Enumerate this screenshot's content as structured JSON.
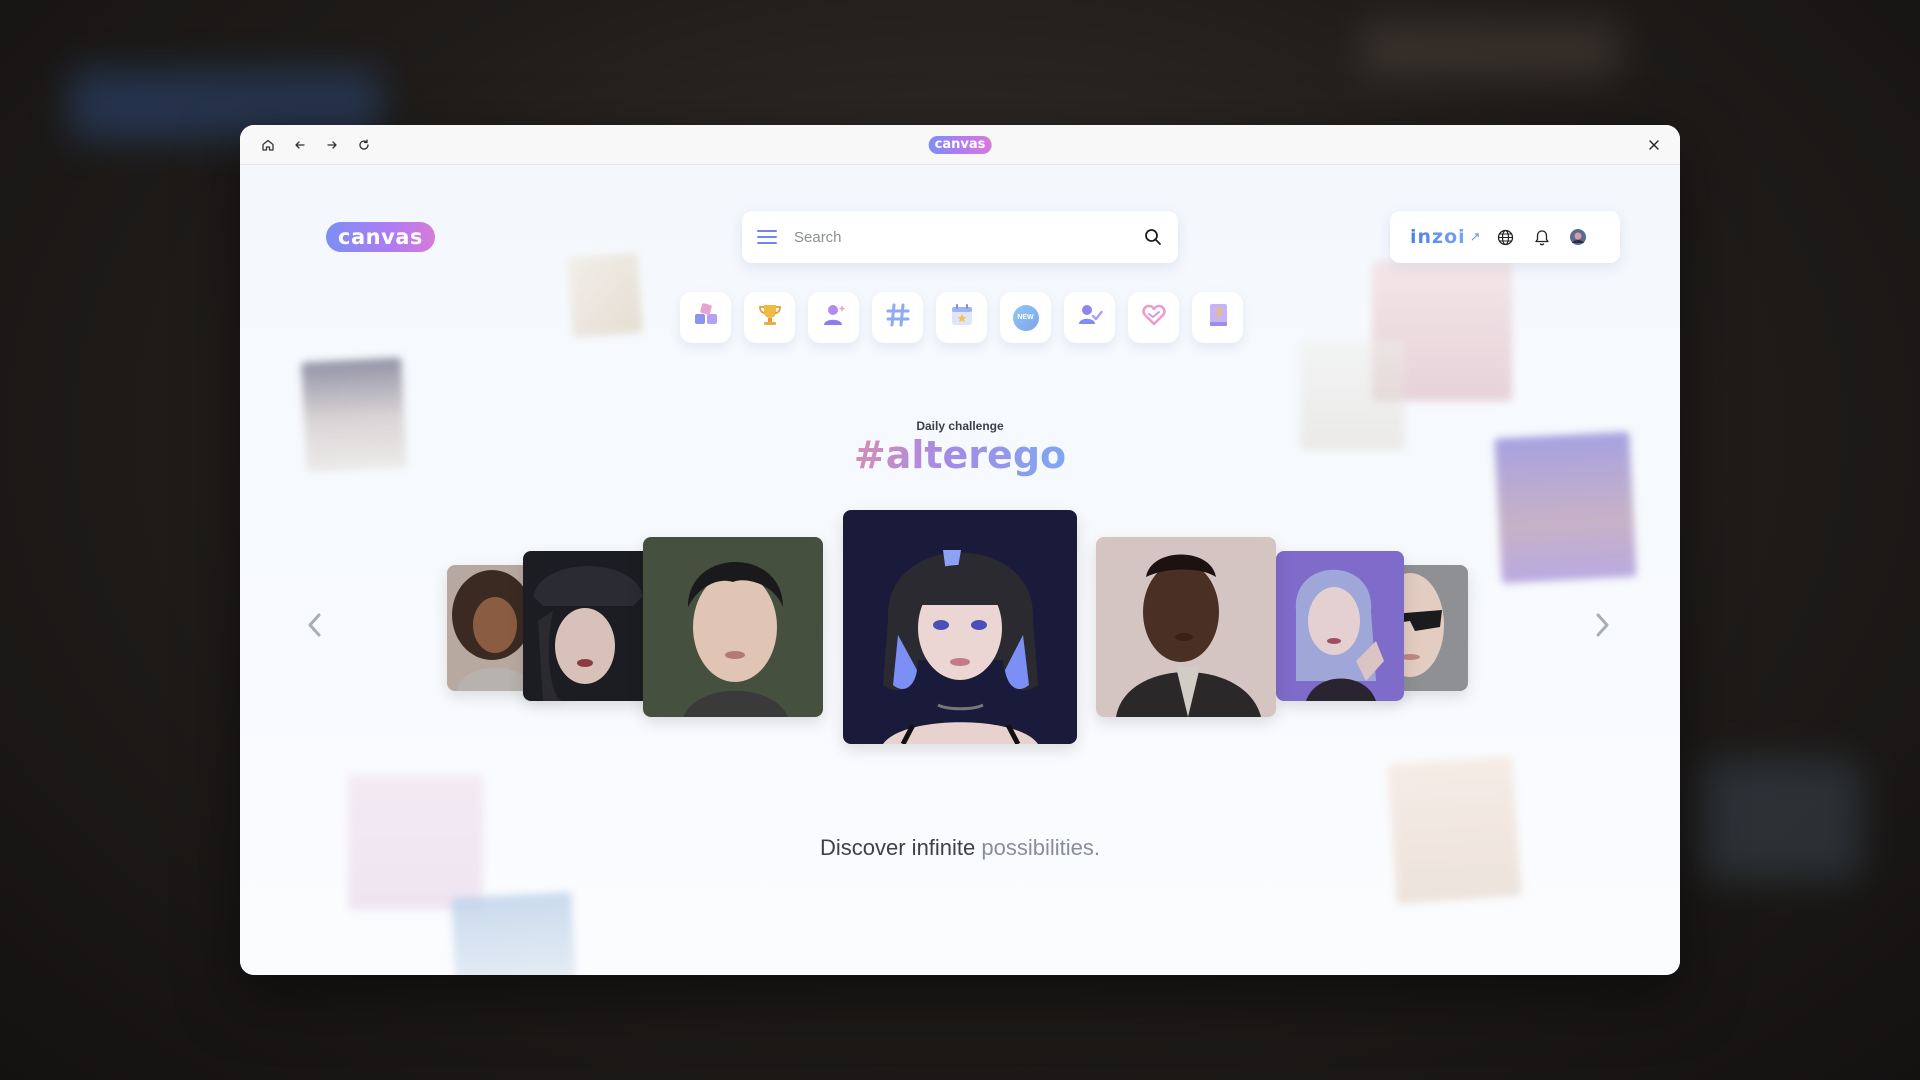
{
  "window": {
    "titlebar": {
      "home_icon": "home-icon",
      "back_icon": "arrow-left-icon",
      "forward_icon": "arrow-right-icon",
      "reload_icon": "reload-icon",
      "title_logo": "canvas",
      "close_icon": "close-icon"
    }
  },
  "header": {
    "logo_text": "canvas",
    "search": {
      "placeholder": "Search",
      "menu_icon": "hamburger-menu-icon",
      "search_icon": "search-icon"
    },
    "right": {
      "brand_link": "inzoi",
      "brand_arrow": "↗",
      "globe_icon": "globe-icon",
      "bell_icon": "bell-icon",
      "avatar": "avatar"
    }
  },
  "categories": [
    {
      "name": "all-categories",
      "icon": "grid-blocks-icon"
    },
    {
      "name": "trophy",
      "icon": "trophy-icon"
    },
    {
      "name": "creators",
      "icon": "person-sparkle-icon"
    },
    {
      "name": "hashtags",
      "icon": "hashtag-icon"
    },
    {
      "name": "events",
      "icon": "calendar-star-icon"
    },
    {
      "name": "new",
      "icon": "new-badge-icon",
      "badge_text": "NEW"
    },
    {
      "name": "following",
      "icon": "person-check-icon"
    },
    {
      "name": "likes",
      "icon": "heart-icon"
    },
    {
      "name": "guide",
      "icon": "book-question-icon"
    }
  ],
  "challenge": {
    "label": "Daily challenge",
    "hashtag": "#alterego"
  },
  "carousel": {
    "prev_icon": "chevron-left-icon",
    "next_icon": "chevron-right-icon",
    "items": [
      {
        "name": "portrait-curly-hair-woman"
      },
      {
        "name": "portrait-black-cap-woman"
      },
      {
        "name": "portrait-young-man"
      },
      {
        "name": "portrait-blue-bob-woman"
      },
      {
        "name": "portrait-leather-jacket-man"
      },
      {
        "name": "portrait-purple-hair-woman"
      },
      {
        "name": "portrait-sunglasses-bald"
      }
    ]
  },
  "tagline": {
    "part1": "Discover infinite",
    "part2": " possibilities."
  },
  "colors": {
    "accent_blue": "#7b8ff5",
    "accent_purple": "#b07bf2",
    "hashtag_pink": "#d48fb5"
  }
}
